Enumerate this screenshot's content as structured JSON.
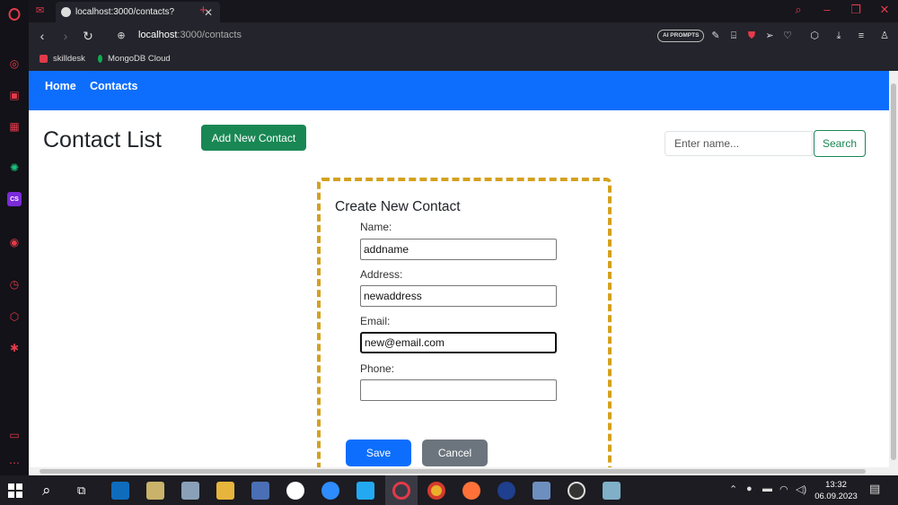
{
  "browser": {
    "tab_title": "localhost:3000/contacts?",
    "tab_close": "✕",
    "new_tab": "+",
    "url_host": "localhost",
    "url_rest": ":3000/contacts",
    "ai_prompts": "AI PROMPTS",
    "bookmarks": [
      {
        "label": "skilldesk",
        "color": "#e23a4a"
      },
      {
        "label": "MongoDB Cloud",
        "color": "#13aa52"
      }
    ]
  },
  "navbar": {
    "home": "Home",
    "contacts": "Contacts",
    "color": "#0d6efd"
  },
  "page": {
    "title": "Contact List",
    "add_button": "Add New Contact",
    "search_placeholder": "Enter name...",
    "search_button": "Search"
  },
  "form": {
    "title": "Create New Contact",
    "name_label": "Name:",
    "name_value": "addname",
    "address_label": "Address:",
    "address_value": "newaddress",
    "email_label": "Email:",
    "email_value": "new@email.com",
    "phone_label": "Phone:",
    "phone_value": "",
    "save": "Save",
    "cancel": "Cancel",
    "border_color": "#d4a11e"
  },
  "taskbar": {
    "time": "13:32",
    "date": "06.09.2023"
  }
}
